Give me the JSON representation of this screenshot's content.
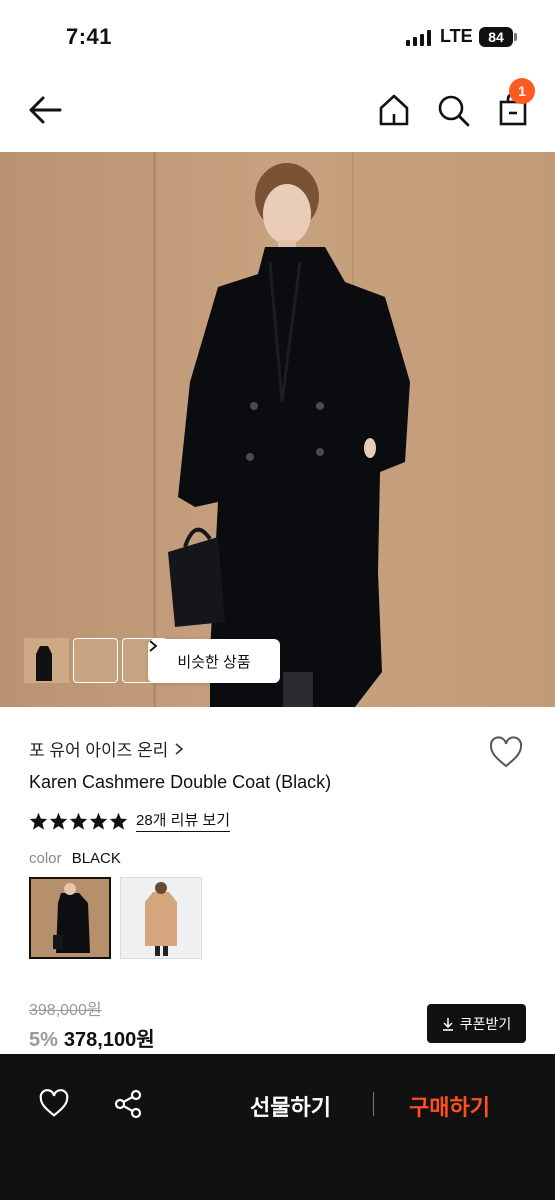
{
  "status_bar": {
    "time": "7:41",
    "network": "LTE",
    "battery": "84"
  },
  "header": {
    "back_icon": "arrow-left-icon",
    "home_icon": "home-icon",
    "search_icon": "search-icon",
    "bag_icon": "shopping-bag-icon",
    "cart_count": "1",
    "badge_color": "#ff5a1f"
  },
  "hero": {
    "similar_products_label": "비슷한 상품",
    "similar_products_icon": "chevron-right-icon"
  },
  "product": {
    "brand": "포 유어 아이즈 온리",
    "brand_icon": "chevron-right-icon",
    "name": "Karen Cashmere Double Coat (Black)",
    "wishlist_icon": "heart-outline-icon",
    "rating_stars": 5,
    "review_link": "28개 리뷰 보기",
    "color_label": "color",
    "color_value": "BLACK",
    "original_price": "398,000원",
    "discount": "5%",
    "price": "378,100원",
    "coupon_label": "쿠폰받기",
    "coupon_icon": "download-icon"
  },
  "bottom_bar": {
    "heart_icon": "heart-outline-icon",
    "share_icon": "share-icon",
    "gift_label": "선물하기",
    "buy_label": "구매하기",
    "buy_color": "#ff4f1f"
  }
}
